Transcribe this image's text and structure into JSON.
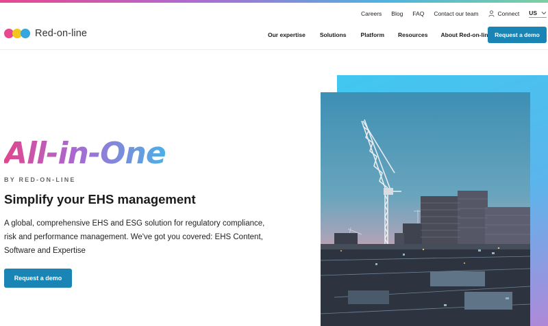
{
  "utility_nav": {
    "items": [
      "Careers",
      "Blog",
      "FAQ",
      "Contact our team"
    ],
    "connect_label": "Connect",
    "language": "US"
  },
  "brand": {
    "name": "Red-on-line",
    "colors": {
      "pink": "#e8488f",
      "yellow": "#f4c51c",
      "blue": "#38a6de",
      "accent": "#1a84b5"
    }
  },
  "main_nav": {
    "items": [
      "Our expertise",
      "Solutions",
      "Platform",
      "Resources",
      "About Red-on-line"
    ],
    "cta_label": "Request a demo"
  },
  "hero": {
    "title": "All-in-One",
    "byline": "BY RED-ON-LINE",
    "subtitle": "Simplify your EHS management",
    "description": "A global, comprehensive EHS and ESG solution for regulatory compliance, risk and performance management. We've got you covered: EHS Content, Software and Expertise",
    "cta_label": "Request a demo"
  },
  "icons": {
    "connect": "person-icon",
    "language_toggle": "chevron-down-icon"
  }
}
